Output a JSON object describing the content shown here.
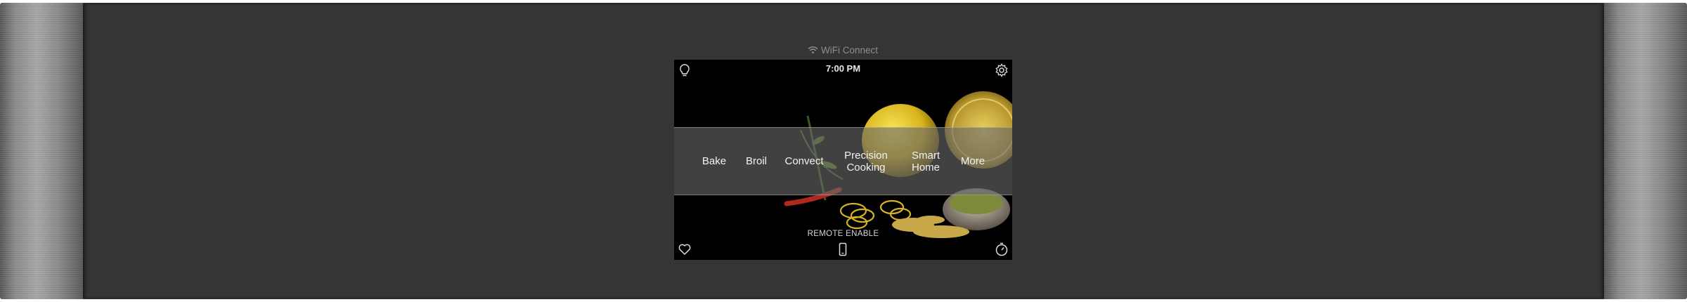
{
  "header": {
    "wifi_label": "WiFi Connect"
  },
  "screen": {
    "time": "7:00 PM",
    "menu": [
      {
        "label": "Bake"
      },
      {
        "label": "Broil"
      },
      {
        "label": "Convect"
      },
      {
        "label": "Precision\nCooking"
      },
      {
        "label": "Smart\nHome"
      },
      {
        "label": "More"
      }
    ],
    "remote_label": "REMOTE ENABLE",
    "icons": {
      "top_left": "light-bulb-icon",
      "top_right": "gear-icon",
      "bottom_left": "heart-icon",
      "bottom_center": "phone-icon",
      "bottom_right": "timer-icon"
    }
  },
  "colors": {
    "panel": "#353535",
    "screen": "#000000",
    "text": "#f2f2f2"
  }
}
